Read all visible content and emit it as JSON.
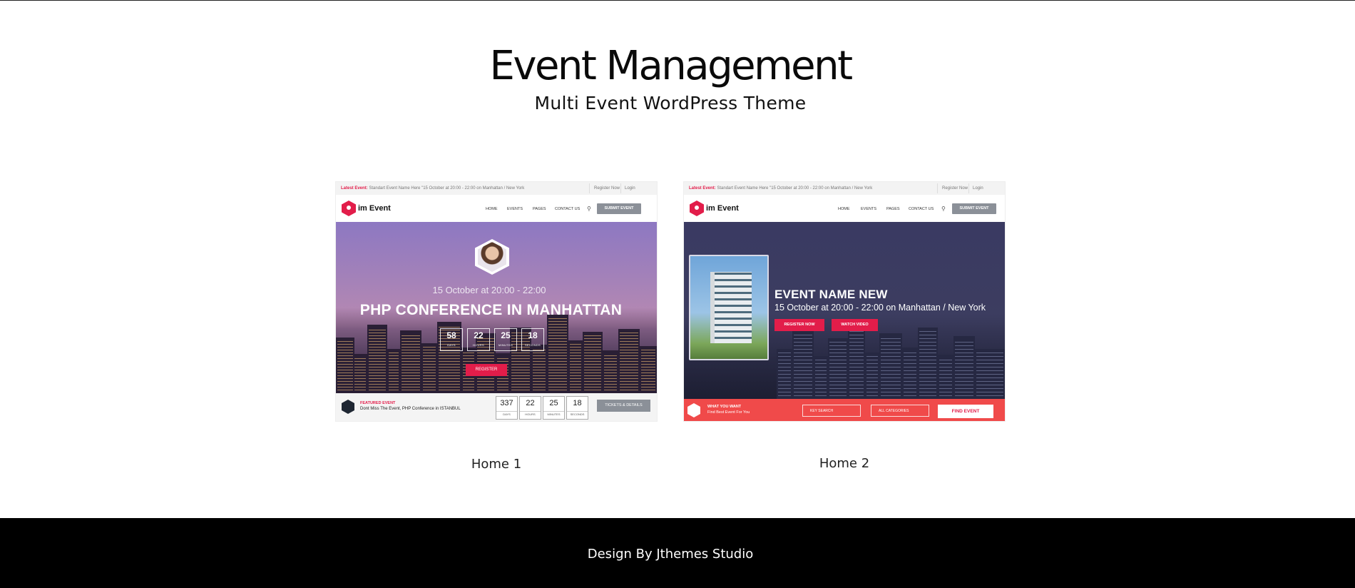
{
  "hero": {
    "title": "Event Management",
    "subtitle": "Multi Event WordPress Theme"
  },
  "demos": [
    {
      "label": "Home 1",
      "preview": {
        "topbar_latest_label": "Latest Event:",
        "topbar_latest_text": "Standart Event Name Here \"15 October at 20:00 - 22:00 on Manhattan / New York",
        "topbar_register": "Register Now",
        "topbar_login": "Login",
        "logo": "im Event",
        "menu": [
          "HOME",
          "EVENTS",
          "PAGES",
          "CONTACT US"
        ],
        "submit_button": "SUBMIT EVENT",
        "date": "15 October at 20:00 - 22:00",
        "title": "PHP CONFERENCE IN MANHATTAN",
        "countdown": [
          {
            "value": "58",
            "unit": "DAYS"
          },
          {
            "value": "22",
            "unit": "HOURS"
          },
          {
            "value": "25",
            "unit": "MINUTES"
          },
          {
            "value": "18",
            "unit": "SECONDS"
          }
        ],
        "register_button": "REGISTER",
        "featured_kicker": "FEATURED EVENT",
        "featured_text": "Dont Miss The Event, PHP Conference in ISTANBUL",
        "bottom_countdown": [
          {
            "value": "337",
            "unit": "DAYS"
          },
          {
            "value": "22",
            "unit": "HOURS"
          },
          {
            "value": "25",
            "unit": "MINUTES"
          },
          {
            "value": "18",
            "unit": "SECONDS"
          }
        ],
        "tickets_button": "TICKETS & DETAILS"
      }
    },
    {
      "label": "Home 2",
      "preview": {
        "topbar_latest_label": "Latest Event:",
        "topbar_latest_text": "Standart Event Name Here \"15 October at 20:00 - 22:00 on Manhattan / New York",
        "topbar_register": "Register Now",
        "topbar_login": "Login",
        "logo": "im Event",
        "menu": [
          "HOME",
          "EVENTS",
          "PAGES",
          "CONTACT US"
        ],
        "submit_button": "SUBMIT EVENT",
        "title": "EVENT NAME NEW",
        "subtitle": "15 October at 20:00 - 22:00 on Manhattan / New York",
        "register_button": "REGISTER NOW",
        "video_button": "WATCH VIDEO",
        "want_kicker": "WHAT YOU WANT",
        "want_text": "Find Best Event For You",
        "key_field": "KEY SEARCH",
        "category_field": "ALL CATEGORIES",
        "find_button": "FIND EVENT"
      }
    }
  ],
  "footer": {
    "credit": "Design By Jthemes Studio"
  },
  "colors": {
    "accent": "#e21d4a",
    "footer_bg": "#000000"
  }
}
